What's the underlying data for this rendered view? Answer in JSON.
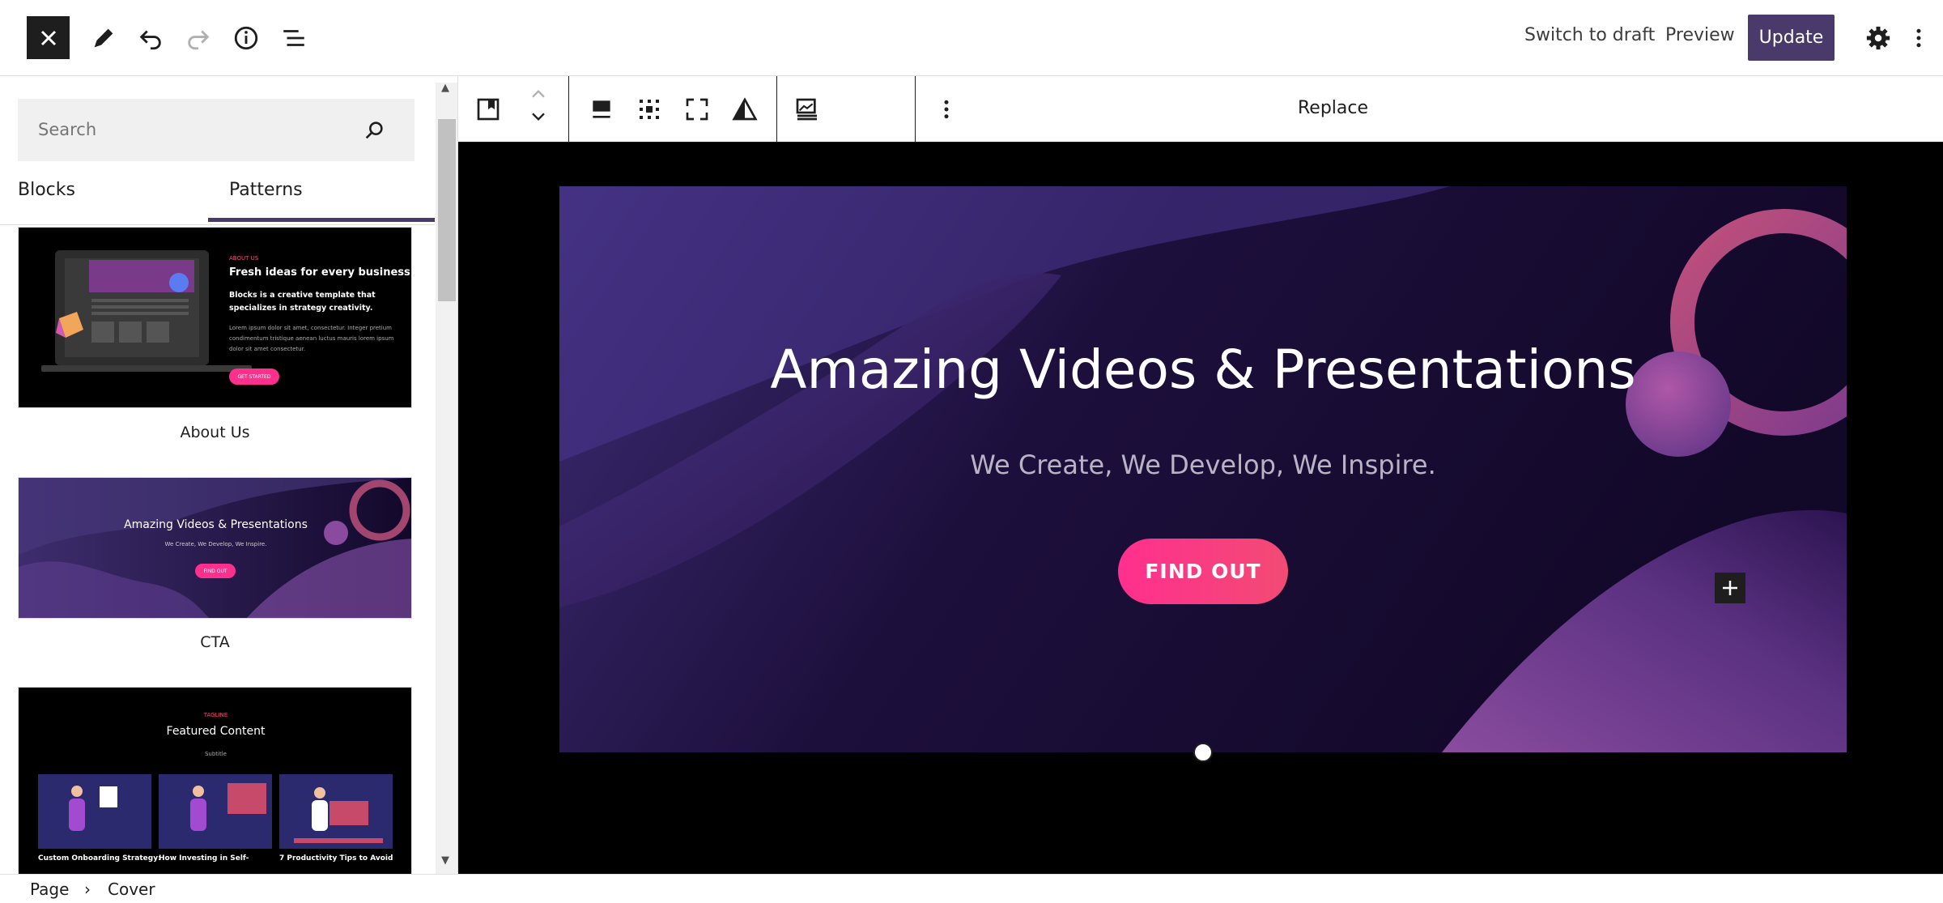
{
  "topbar": {
    "close_icon": "close-icon",
    "tools": [
      {
        "name": "pencil-icon"
      },
      {
        "name": "undo-icon"
      },
      {
        "name": "redo-icon"
      },
      {
        "name": "info-icon"
      },
      {
        "name": "list-view-icon"
      }
    ],
    "switch_to_draft": "Switch to draft",
    "preview": "Preview",
    "update": "Update",
    "accent_color": "#4a3a6b"
  },
  "sidebar": {
    "search_placeholder": "Search",
    "tabs": [
      {
        "label": "Blocks",
        "active": false
      },
      {
        "label": "Patterns",
        "active": true
      }
    ],
    "patterns": [
      {
        "label": "About Us",
        "preview": {
          "eyebrow": "ABOUT US",
          "heading": "Fresh ideas for every business",
          "subheading": "Blocks is a creative template that specializes in strategy creativity.",
          "body": "Lorem ipsum dolor sit amet, consectetur. Integer pretium condimentum tristique aenean luctus mauris lorem ipsum dolor sit amet consectetur.",
          "button": "GET STARTED"
        }
      },
      {
        "label": "CTA",
        "preview": {
          "heading": "Amazing Videos & Presentations",
          "subheading": "We Create, We Develop, We Inspire.",
          "button": "FIND OUT"
        }
      },
      {
        "label": "",
        "preview": {
          "eyebrow": "TAGLINE",
          "heading": "Featured Content",
          "subheading": "Subtitle",
          "cards": [
            "Custom Onboarding Strategy:",
            "How Investing in Self-",
            "7 Productivity Tips to Avoid"
          ]
        }
      }
    ]
  },
  "block_toolbar": {
    "replace": "Replace"
  },
  "cover": {
    "title": "Amazing Videos & Presentations",
    "subtitle": "We Create, We Develop, We Inspire.",
    "button": "FIND OUT",
    "button_color": "#ff2f8e"
  },
  "breadcrumb": {
    "items": [
      "Page",
      "Cover"
    ]
  }
}
